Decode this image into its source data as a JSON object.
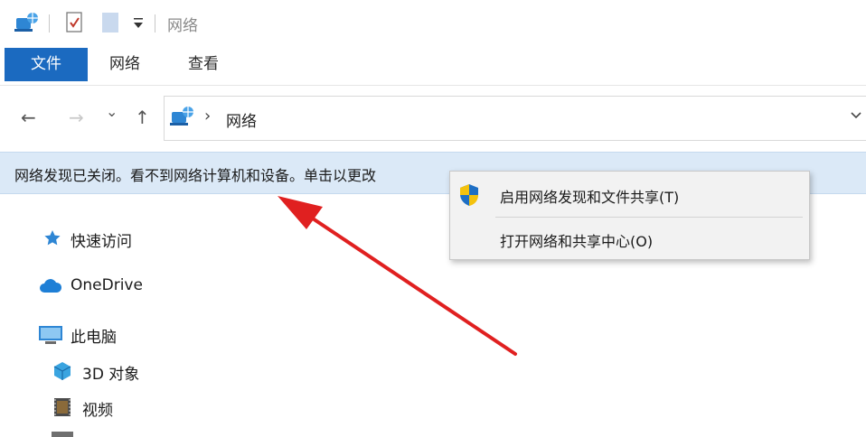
{
  "window": {
    "title": "网络"
  },
  "ribbon": {
    "tabs": [
      {
        "label": "文件"
      },
      {
        "label": "网络"
      },
      {
        "label": "查看"
      }
    ]
  },
  "address_bar": {
    "path": "网络",
    "separator": "›"
  },
  "nav_buttons": {
    "back": "←",
    "forward": "→",
    "recent": "⌄",
    "up": "↑"
  },
  "info_bar": {
    "text": "网络发现已关闭。看不到网络计算机和设备。单击以更改"
  },
  "context_menu": {
    "items": [
      {
        "label": "启用网络发现和文件共享(T)"
      },
      {
        "label": "打开网络和共享中心(O)"
      }
    ]
  },
  "nav_pane": {
    "items": [
      {
        "label": "快速访问"
      },
      {
        "label": "OneDrive"
      },
      {
        "label": "此电脑"
      },
      {
        "label": "3D 对象"
      },
      {
        "label": "视频"
      }
    ]
  },
  "colors": {
    "accent": "#1b6ac0",
    "info_bar": "#dbe9f7",
    "arrow": "#e02020"
  }
}
